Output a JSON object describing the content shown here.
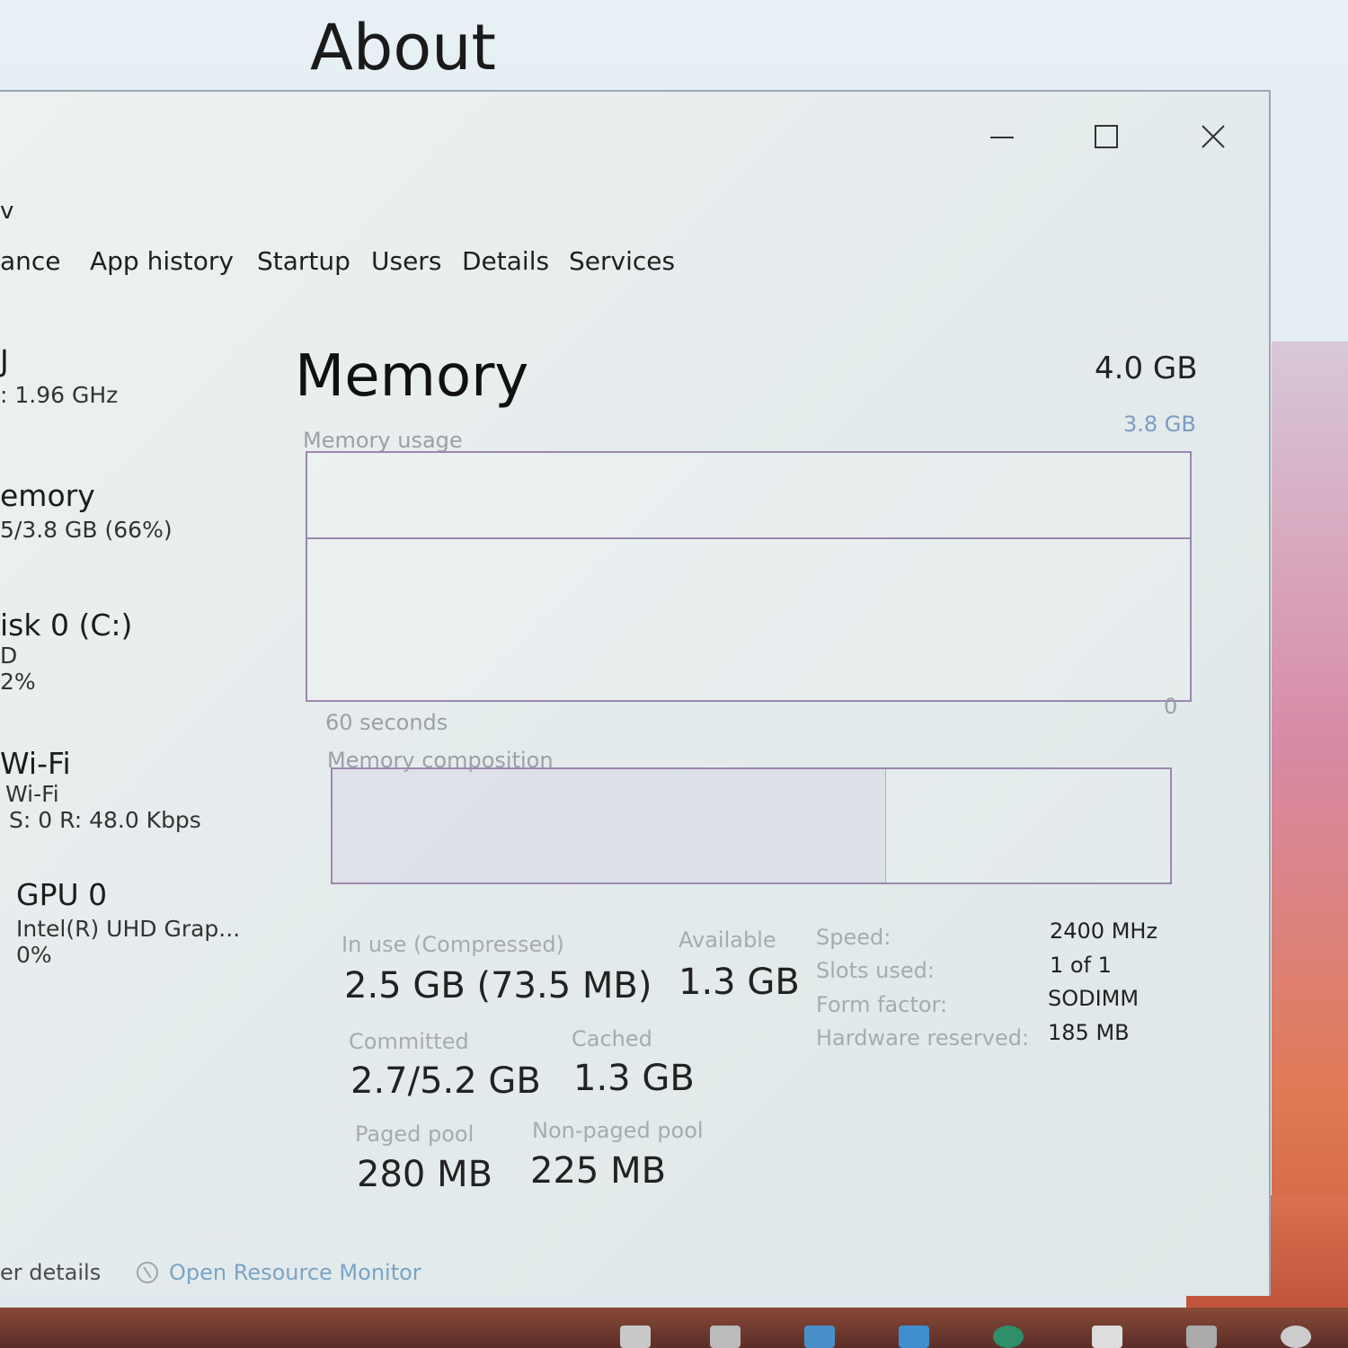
{
  "background_window": {
    "title": "About"
  },
  "window_controls": {
    "minimize": "minimize",
    "maximize": "maximize",
    "close": "close"
  },
  "menu_fragment": "v",
  "tabs": [
    {
      "label": "ance"
    },
    {
      "label": "App history"
    },
    {
      "label": "Startup"
    },
    {
      "label": "Users"
    },
    {
      "label": "Details"
    },
    {
      "label": "Services"
    }
  ],
  "sidebar": {
    "items": [
      {
        "name": "J",
        "sub": ": 1.96 GHz",
        "sub2": ""
      },
      {
        "name": "emory",
        "sub": "5/3.8 GB (66%)",
        "sub2": ""
      },
      {
        "name": "isk 0 (C:)",
        "sub": "D",
        "sub2": "2%"
      },
      {
        "name": "Wi-Fi",
        "sub": "Wi-Fi",
        "sub2": "S: 0  R: 48.0 Kbps"
      },
      {
        "name": "GPU 0",
        "sub": "Intel(R) UHD Grap...",
        "sub2": "0%"
      }
    ]
  },
  "memory": {
    "title": "Memory",
    "total": "4.0 GB",
    "usage_label": "Memory usage",
    "usage_max": "3.8 GB",
    "time_label": "60 seconds",
    "time_end": "0",
    "composition_label": "Memory composition",
    "usage_fraction": 0.66,
    "stats": {
      "in_use_label": "In use (Compressed)",
      "in_use_value": "2.5 GB (73.5 MB)",
      "available_label": "Available",
      "available_value": "1.3 GB",
      "committed_label": "Committed",
      "committed_value": "2.7/5.2 GB",
      "cached_label": "Cached",
      "cached_value": "1.3 GB",
      "paged_label": "Paged pool",
      "paged_value": "280 MB",
      "nonpaged_label": "Non-paged pool",
      "nonpaged_value": "225 MB"
    },
    "specs": [
      {
        "label": "Speed:",
        "value": "2400 MHz"
      },
      {
        "label": "Slots used:",
        "value": "1 of 1"
      },
      {
        "label": "Form factor:",
        "value": "SODIMM"
      },
      {
        "label": "Hardware reserved:",
        "value": "185 MB"
      }
    ]
  },
  "footer": {
    "details": "er details",
    "resource_monitor": "Open Resource Monitor"
  },
  "colors": {
    "graph_border": "#9a88b0",
    "taskbar": "#6a3a30"
  }
}
